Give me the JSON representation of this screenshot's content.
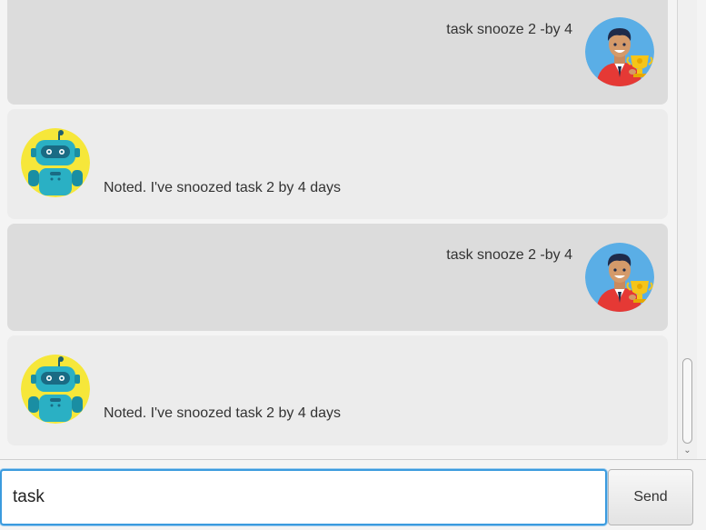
{
  "dialogs": [
    {
      "role": "user",
      "text": "task snooze 2 -by 4",
      "avatar_icon": "user-trophy-avatar"
    },
    {
      "role": "bot",
      "text": "Noted. I've snoozed task 2 by 4 days",
      "avatar_icon": "robot-avatar"
    },
    {
      "role": "user",
      "text": "task snooze 2 -by 4",
      "avatar_icon": "user-trophy-avatar"
    },
    {
      "role": "bot",
      "text": "Noted. I've snoozed task 2 by 4 days",
      "avatar_icon": "robot-avatar"
    }
  ],
  "input": {
    "value": "task",
    "placeholder": ""
  },
  "send_button": {
    "label": "Send"
  },
  "colors": {
    "user_bubble": "#dcdcdc",
    "bot_bubble": "#ececec",
    "focus_border": "#3b9bde",
    "user_avatar_bg": "#5aaee6",
    "bot_avatar_bg": "#f6e73a"
  }
}
